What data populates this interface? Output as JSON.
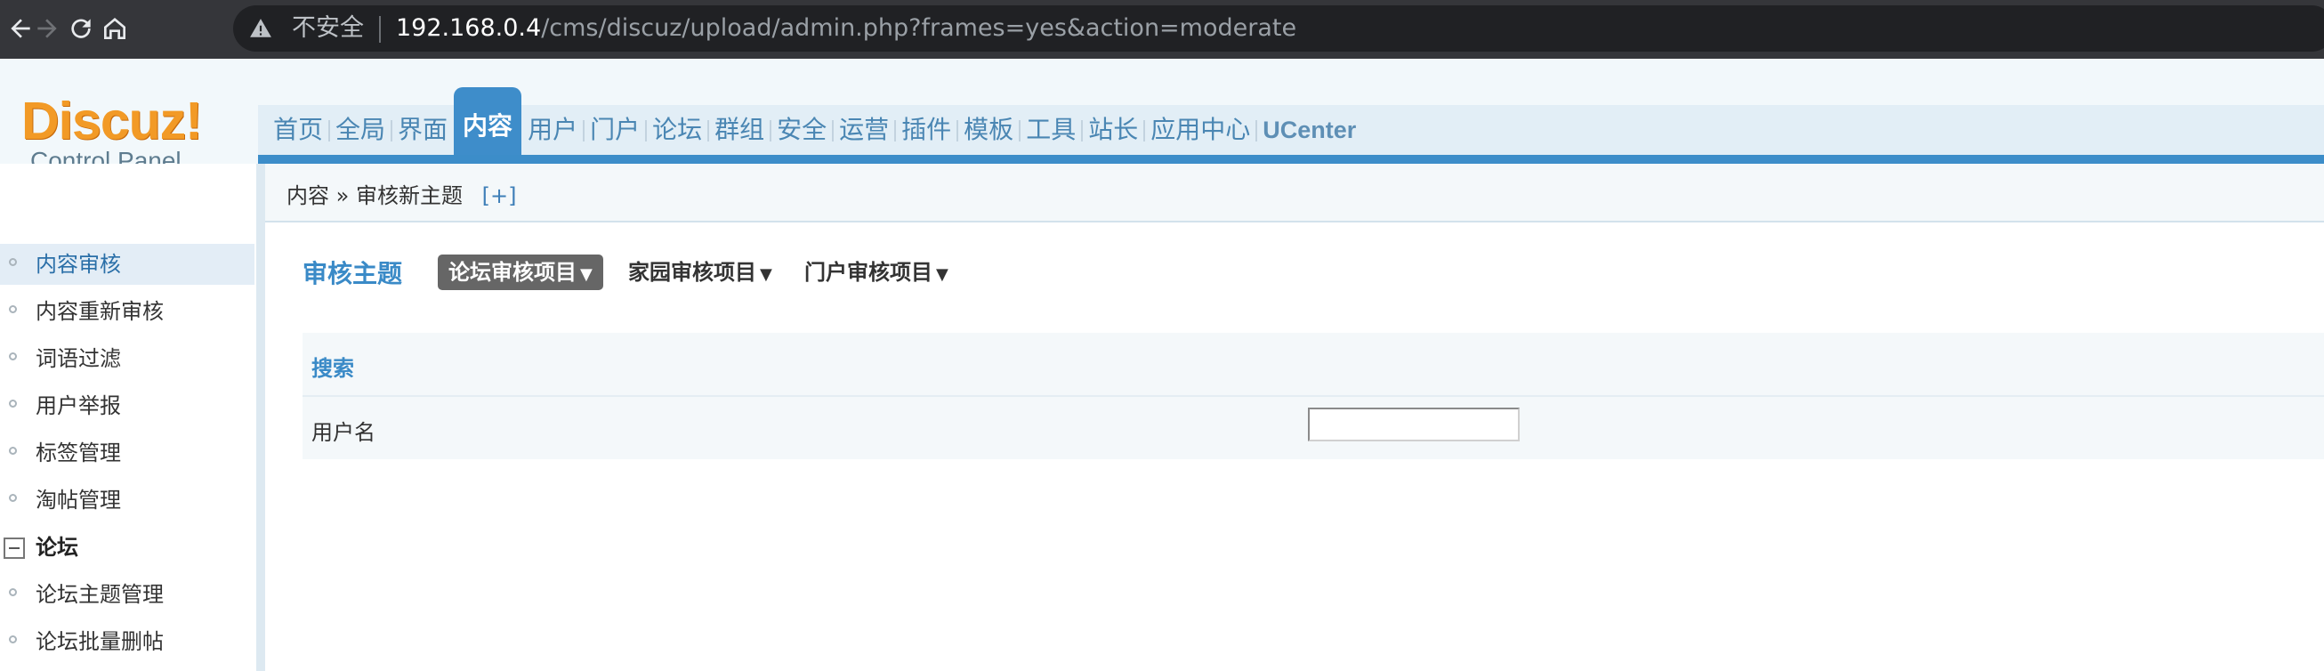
{
  "browser": {
    "security_label": "不安全",
    "url_host": "192.168.0.4",
    "url_path": "/cms/discuz/upload/admin.php?frames=yes&action=moderate"
  },
  "logo": {
    "main": "Discuz!",
    "sub": "Control Panel"
  },
  "topnav": {
    "items": [
      "首页",
      "全局",
      "界面",
      "内容",
      "用户",
      "门户",
      "论坛",
      "群组",
      "安全",
      "运营",
      "插件",
      "模板",
      "工具",
      "站长",
      "应用中心",
      "UCenter"
    ],
    "active_index": 3
  },
  "breadcrumb": {
    "section": "内容",
    "separator": "»",
    "page": "审核新主题",
    "add": "[+]"
  },
  "sidebar": {
    "items": [
      "内容审核",
      "内容重新审核",
      "词语过滤",
      "用户举报",
      "标签管理",
      "淘帖管理"
    ],
    "group": "论坛",
    "group_items": [
      "论坛主题管理",
      "论坛批量删帖"
    ],
    "active_index": 0
  },
  "main": {
    "title": "审核主题",
    "tabs": [
      "论坛审核项目",
      "家园审核项目",
      "门户审核项目"
    ],
    "tab_arrow": "▼",
    "search_heading": "搜索",
    "username_label": "用户名",
    "username_value": ""
  },
  "colors": {
    "accent": "#3e8dca",
    "logo": "#f29a26",
    "chrome": "#35363a"
  }
}
